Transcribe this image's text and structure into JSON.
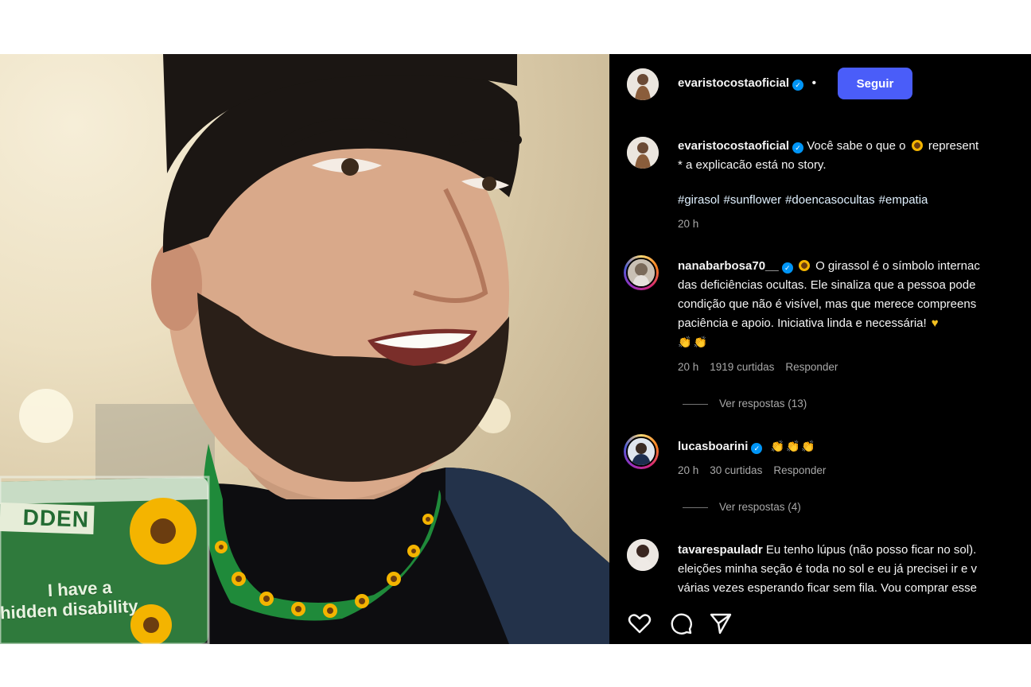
{
  "header": {
    "username": "evaristocostaoficial",
    "separator": "•",
    "follow_label": "Seguir"
  },
  "caption": {
    "username": "evaristocostaoficial",
    "line1": "Você sabe o que o",
    "line1_end": "represent",
    "line2": "* a explicacão está no story.",
    "hashtags": [
      "#girasol",
      "#sunflower",
      "#doencasocultas",
      "#empatia"
    ],
    "time": "20 h"
  },
  "comments": [
    {
      "username": "nanabarbosa70__",
      "lines": [
        "O girassol é o símbolo internac",
        "das deficiências ocultas. Ele sinaliza que a pessoa pode",
        "condição que não é visível, mas que merece compreens",
        "paciência e apoio. Iniciativa linda e necessária!"
      ],
      "time": "20 h",
      "likes": "1919 curtidas",
      "reply": "Responder",
      "view_replies": "Ver respostas (13)"
    },
    {
      "username": "lucasboarini",
      "time": "20 h",
      "likes": "30 curtidas",
      "reply": "Responder",
      "view_replies": "Ver respostas (4)"
    },
    {
      "username": "tavarespauladr",
      "lines": [
        "Eu tenho lúpus (não posso ficar no sol).",
        "eleições minha seção é toda no sol e eu já precisei ir e v",
        "várias vezes esperando ficar sem fila. Vou comprar esse"
      ]
    }
  ],
  "photo": {
    "badge_brand": "DDEN",
    "badge_line1": "I have a",
    "badge_line2": "hidden disability"
  },
  "colors": {
    "panel_bg": "#000000",
    "follow_button": "#4a5df9",
    "verified": "#0095f6",
    "lanyard_green": "#1f8a3a"
  },
  "icons": [
    "heart-icon",
    "comment-icon",
    "share-icon",
    "verified-icon",
    "sunflower-emoji",
    "clap-emoji",
    "yellow-heart-emoji"
  ]
}
